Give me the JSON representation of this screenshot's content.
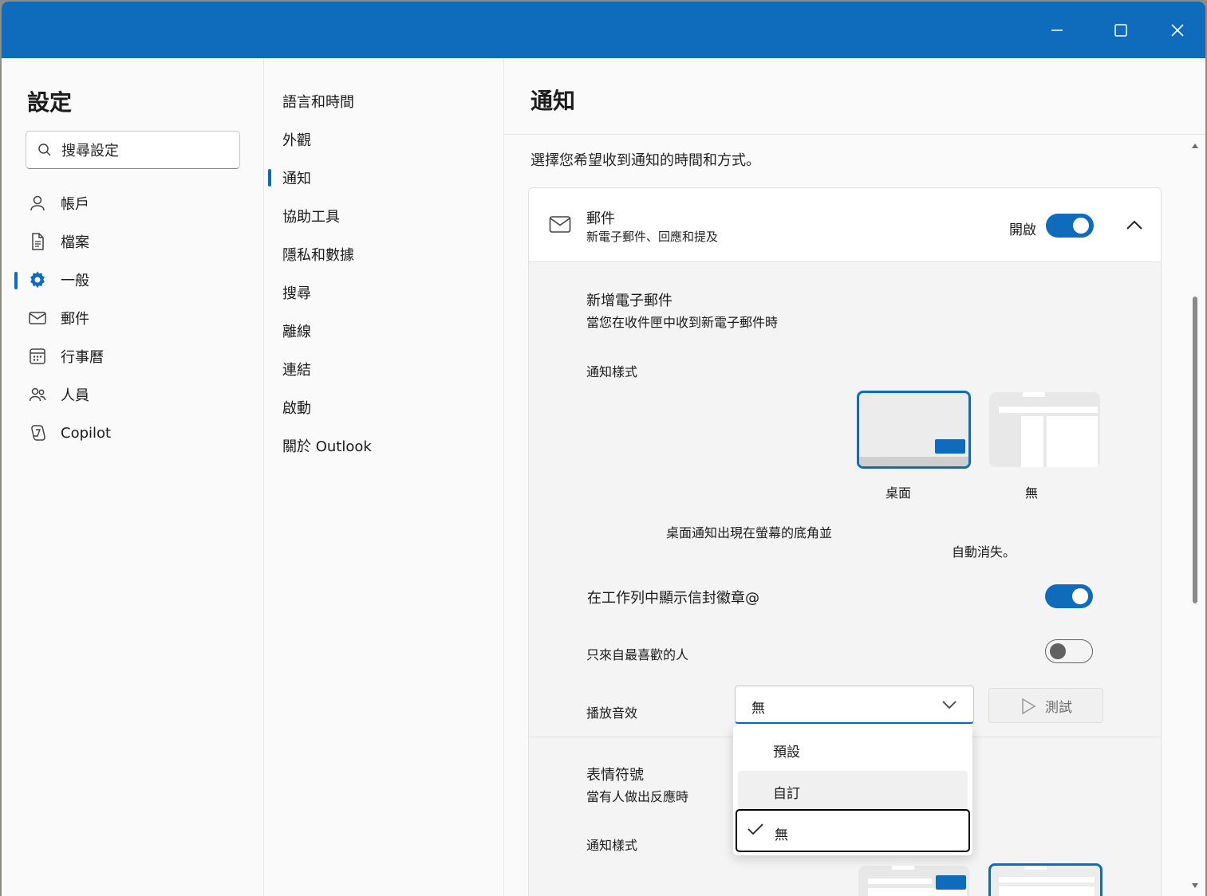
{
  "window": {
    "minimize": "minimize",
    "maximize": "maximize",
    "close": "close"
  },
  "sidebar": {
    "title": "設定",
    "search_placeholder": "搜尋設定",
    "items": [
      {
        "label": "帳戶",
        "icon": "person-icon"
      },
      {
        "label": "檔案",
        "icon": "document-icon"
      },
      {
        "label": "一般",
        "icon": "gear-icon",
        "selected": true
      },
      {
        "label": "郵件",
        "icon": "mail-icon"
      },
      {
        "label": "行事曆",
        "icon": "calendar-icon"
      },
      {
        "label": "人員",
        "icon": "people-icon"
      },
      {
        "label": "Copilot",
        "icon": "copilot-icon"
      }
    ]
  },
  "subnav": {
    "items": [
      {
        "label": "語言和時間"
      },
      {
        "label": "外觀"
      },
      {
        "label": "通知",
        "selected": true
      },
      {
        "label": "協助工具"
      },
      {
        "label": "隱私和數據"
      },
      {
        "label": "搜尋"
      },
      {
        "label": "離線"
      },
      {
        "label": "連結"
      },
      {
        "label": "啟動"
      },
      {
        "label": "關於 Outlook"
      }
    ]
  },
  "main": {
    "title": "通知",
    "subtitle": "選擇您希望收到通知的時間和方式。",
    "card": {
      "title": "郵件",
      "description": "新電子郵件、回應和提及",
      "toggle_label": "開啟",
      "toggle_on": true
    },
    "new_email": {
      "title": "新增電子郵件",
      "description": "當您在收件匣中收到新電子郵件時",
      "style_label": "通知樣式",
      "style_desktop": "桌面",
      "style_none": "無",
      "style_desc_line1": "桌面通知出現在螢幕的底角並",
      "style_desc_line2": "自動消失。",
      "badge_label": "在工作列中顯示信封徽章@",
      "badge_on": true,
      "favorites_label": "只來自最喜歡的人",
      "favorites_on": false,
      "sound_label": "播放音效",
      "sound_value": "無",
      "test_label": "測試"
    },
    "reactions": {
      "title": "表情符號",
      "description": "當有人做出反應時",
      "style_label": "通知樣式"
    }
  },
  "dropdown": {
    "options": [
      "預設",
      "自訂",
      "無"
    ],
    "selected": "無",
    "hovered": "自訂"
  },
  "colors": {
    "accent": "#0f6cbd",
    "titlebar": "#0f6cbd"
  }
}
